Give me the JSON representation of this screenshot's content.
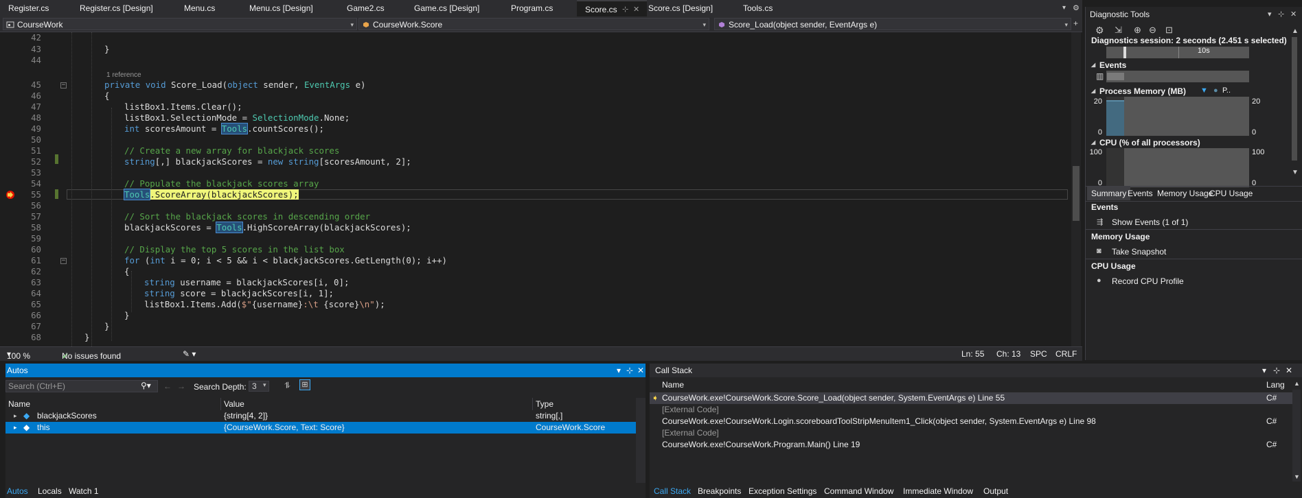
{
  "tabs": [
    {
      "label": "Register.cs"
    },
    {
      "label": "Register.cs [Design]"
    },
    {
      "label": "Menu.cs"
    },
    {
      "label": "Menu.cs [Design]"
    },
    {
      "label": "Game2.cs"
    },
    {
      "label": "Game.cs [Design]"
    },
    {
      "label": "Program.cs"
    },
    {
      "label": "Score.cs"
    },
    {
      "label": "Score.cs [Design]"
    },
    {
      "label": "Tools.cs"
    }
  ],
  "tab_pin_glyph": "⊹",
  "tab_close_glyph": "✕",
  "nav": {
    "project": "CourseWork",
    "class": "CourseWork.Score",
    "member": "Score_Load(object sender, EventArgs e)"
  },
  "editor": {
    "reference_hint": "1 reference",
    "line_numbers": [
      "42",
      "43",
      "44",
      "45",
      "46",
      "47",
      "48",
      "49",
      "50",
      "51",
      "52",
      "53",
      "54",
      "55",
      "56",
      "57",
      "58",
      "59",
      "60",
      "61",
      "62",
      "63",
      "64",
      "65",
      "66",
      "67",
      "68"
    ]
  },
  "editor_status": {
    "zoom": "100 %",
    "issues": "No issues found",
    "line": "Ln: 55",
    "col": "Ch: 13",
    "spc": "SPC",
    "crlf": "CRLF"
  },
  "diagnostic": {
    "title": "Diagnostic Tools",
    "session": "Diagnostics session: 2 seconds (2.451 s selected)",
    "timeline_tick": "10s",
    "events_label": "Events",
    "memory_label": "Process Memory (MB)",
    "memory_legend": "P..",
    "memory_max": "20",
    "memory_min": "0",
    "memory_level_pct": 100,
    "cpu_label": "CPU (% of all processors)",
    "cpu_max": "100",
    "cpu_min": "0",
    "tabs": [
      "Summary",
      "Events",
      "Memory Usage",
      "CPU Usage"
    ],
    "sections": {
      "events_title": "Events",
      "events_item": "Show Events (1 of 1)",
      "memory_title": "Memory Usage",
      "memory_item": "Take Snapshot",
      "cpu_title": "CPU Usage",
      "cpu_item": "Record CPU Profile"
    }
  },
  "autos": {
    "title": "Autos",
    "search_placeholder": "Search (Ctrl+E)",
    "search_depth_label": "Search Depth:",
    "search_depth_value": "3",
    "columns": [
      "Name",
      "Value",
      "Type"
    ],
    "rows": [
      {
        "name": "blackjackScores",
        "value": "{string[4, 2]}",
        "type": "string[,]"
      },
      {
        "name": "this",
        "value": "{CourseWork.Score, Text: Score}",
        "type": "CourseWork.Score"
      }
    ],
    "bottom_tabs": [
      "Autos",
      "Locals",
      "Watch 1"
    ]
  },
  "callstack": {
    "title": "Call Stack",
    "columns": [
      "Name",
      "Lang"
    ],
    "rows": [
      {
        "name": "CourseWork.exe!CourseWork.Score.Score_Load(object sender, System.EventArgs e) Line 55",
        "lang": "C#"
      },
      {
        "name": "[External Code]",
        "lang": ""
      },
      {
        "name": "CourseWork.exe!CourseWork.Login.scoreboardToolStripMenuItem1_Click(object sender, System.EventArgs e) Line 98",
        "lang": "C#"
      },
      {
        "name": "[External Code]",
        "lang": ""
      },
      {
        "name": "CourseWork.exe!CourseWork.Program.Main() Line 19",
        "lang": "C#"
      }
    ],
    "bottom_tabs": [
      "Call Stack",
      "Breakpoints",
      "Exception Settings",
      "Command Window",
      "Immediate Window",
      "Output"
    ]
  },
  "colors": {
    "accent": "#007acc",
    "breakpoint": "#e51400",
    "current_line_arrow": "#f8d34b",
    "memory_fill": "#5b8ca7"
  }
}
